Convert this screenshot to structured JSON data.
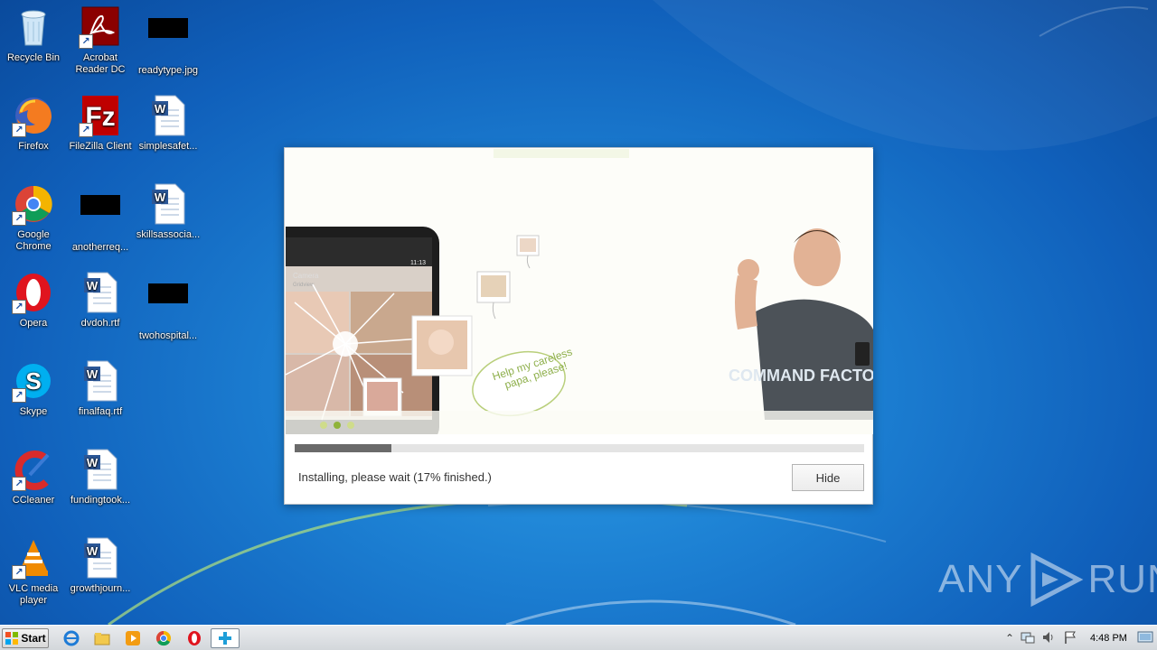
{
  "desktop": {
    "icons": [
      {
        "label": "Recycle Bin",
        "icon": "recycle-bin-icon"
      },
      {
        "label": "Acrobat Reader DC",
        "icon": "acrobat-icon"
      },
      {
        "label": "readytype.jpg",
        "icon": "redacted-thumbnail"
      },
      {
        "label": "Firefox",
        "icon": "firefox-icon"
      },
      {
        "label": "FileZilla Client",
        "icon": "filezilla-icon"
      },
      {
        "label": "simplesafet...",
        "icon": "word-document-icon"
      },
      {
        "label": "Google Chrome",
        "icon": "chrome-icon"
      },
      {
        "label": "anotherreq...",
        "icon": "redacted-thumbnail"
      },
      {
        "label": "skillsassocia...",
        "icon": "word-document-icon"
      },
      {
        "label": "Opera",
        "icon": "opera-icon"
      },
      {
        "label": "dvdoh.rtf",
        "icon": "word-document-icon"
      },
      {
        "label": "twohospital...",
        "icon": "redacted-thumbnail"
      },
      {
        "label": "Skype",
        "icon": "skype-icon"
      },
      {
        "label": "finalfaq.rtf",
        "icon": "word-document-icon"
      },
      {
        "label": "CCleaner",
        "icon": "ccleaner-icon"
      },
      {
        "label": "fundingtook...",
        "icon": "word-document-icon"
      },
      {
        "label": "VLC media player",
        "icon": "vlc-icon"
      },
      {
        "label": "growthjourn...",
        "icon": "word-document-icon"
      }
    ]
  },
  "installer": {
    "banner": {
      "phone_app_title": "Camera",
      "phone_app_subtitle": "Gridview",
      "phone_time": "11:13",
      "speech_bubble": "Help my careless papa, please!",
      "shirt_text": "COMMAND FACTORY",
      "slide_count": 3,
      "active_slide": 2
    },
    "progress_percent": 17,
    "status_text": "Installing, please wait (17% finished.)",
    "hide_label": "Hide"
  },
  "watermark": {
    "left": "ANY",
    "right": "RUN"
  },
  "taskbar": {
    "start_label": "Start",
    "pinned": [
      "internet-explorer-icon",
      "file-explorer-icon",
      "media-player-icon",
      "chrome-icon",
      "opera-icon",
      "installer-icon"
    ],
    "tray": [
      "show-hidden-icons",
      "network-icon",
      "volume-icon",
      "action-center-flag-icon"
    ],
    "clock": "4:48 PM"
  },
  "colors": {
    "desktop_blue": "#1c7fd2",
    "progress_fill": "#6a6a6a",
    "bubble_green": "#8fb04d"
  }
}
